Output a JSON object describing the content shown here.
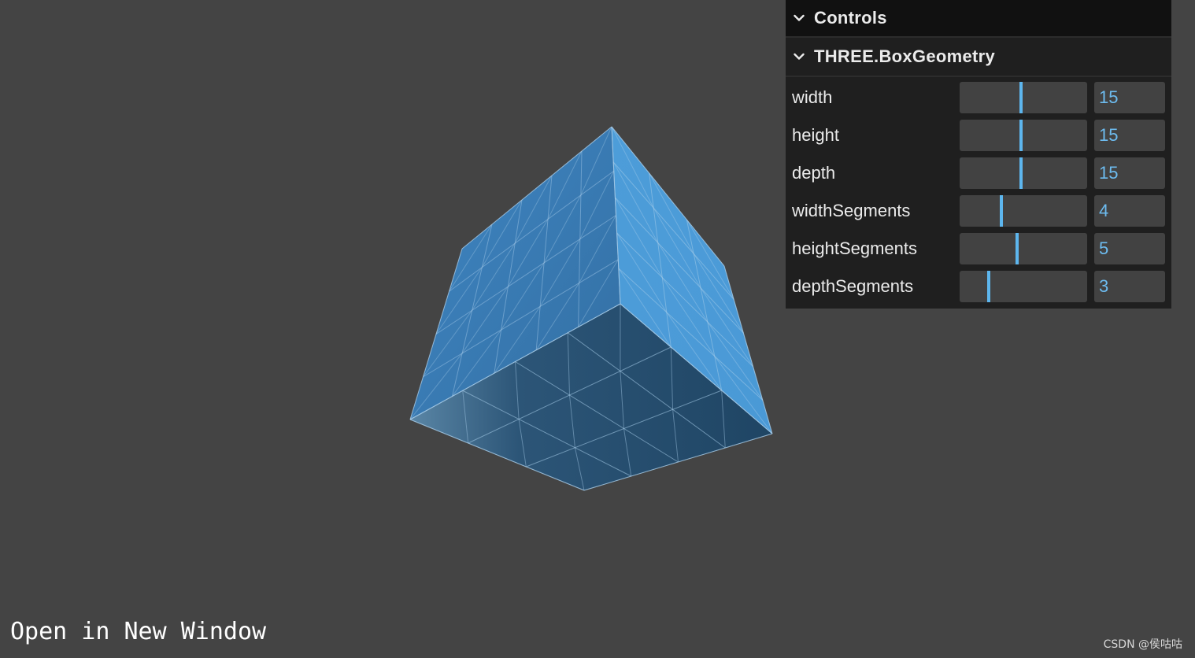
{
  "gui": {
    "title": "Controls",
    "folder_title": "THREE.BoxGeometry",
    "controls": [
      {
        "label": "width",
        "value": "15",
        "fraction": 0.48
      },
      {
        "label": "height",
        "value": "15",
        "fraction": 0.48
      },
      {
        "label": "depth",
        "value": "15",
        "fraction": 0.48
      },
      {
        "label": "widthSegments",
        "value": "4",
        "fraction": 0.33
      },
      {
        "label": "heightSegments",
        "value": "5",
        "fraction": 0.45
      },
      {
        "label": "depthSegments",
        "value": "3",
        "fraction": 0.23
      }
    ],
    "icons": {
      "collapse": "chevron-down-icon"
    },
    "accent_color": "#5db6ee"
  },
  "scene": {
    "background_color": "#444444",
    "mesh_color": "#4a9ad8",
    "wireframe_color": "#a8cdea",
    "width_segments": 4,
    "height_segments": 5,
    "depth_segments": 3
  },
  "link": {
    "open_label": "Open in New Window"
  },
  "watermark": "CSDN @侯咕咕"
}
